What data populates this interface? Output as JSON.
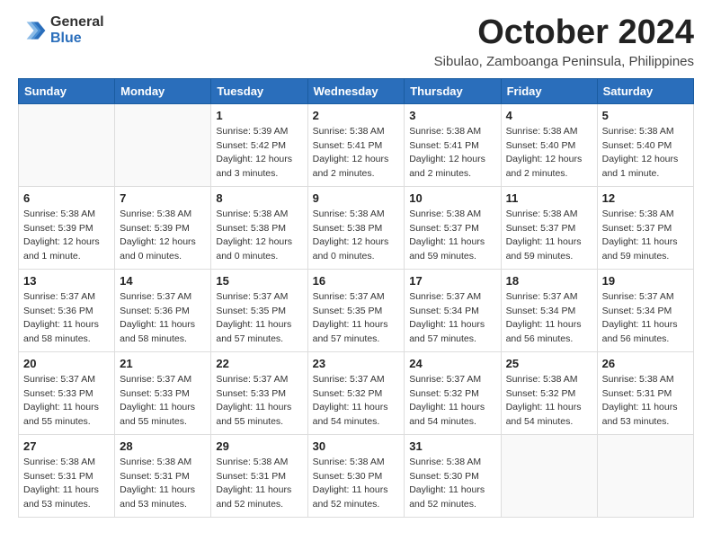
{
  "logo": {
    "general": "General",
    "blue": "Blue"
  },
  "title": "October 2024",
  "subtitle": "Sibulao, Zamboanga Peninsula, Philippines",
  "headers": [
    "Sunday",
    "Monday",
    "Tuesday",
    "Wednesday",
    "Thursday",
    "Friday",
    "Saturday"
  ],
  "weeks": [
    [
      {
        "day": "",
        "info": ""
      },
      {
        "day": "",
        "info": ""
      },
      {
        "day": "1",
        "info": "Sunrise: 5:39 AM\nSunset: 5:42 PM\nDaylight: 12 hours and 3 minutes."
      },
      {
        "day": "2",
        "info": "Sunrise: 5:38 AM\nSunset: 5:41 PM\nDaylight: 12 hours and 2 minutes."
      },
      {
        "day": "3",
        "info": "Sunrise: 5:38 AM\nSunset: 5:41 PM\nDaylight: 12 hours and 2 minutes."
      },
      {
        "day": "4",
        "info": "Sunrise: 5:38 AM\nSunset: 5:40 PM\nDaylight: 12 hours and 2 minutes."
      },
      {
        "day": "5",
        "info": "Sunrise: 5:38 AM\nSunset: 5:40 PM\nDaylight: 12 hours and 1 minute."
      }
    ],
    [
      {
        "day": "6",
        "info": "Sunrise: 5:38 AM\nSunset: 5:39 PM\nDaylight: 12 hours and 1 minute."
      },
      {
        "day": "7",
        "info": "Sunrise: 5:38 AM\nSunset: 5:39 PM\nDaylight: 12 hours and 0 minutes."
      },
      {
        "day": "8",
        "info": "Sunrise: 5:38 AM\nSunset: 5:38 PM\nDaylight: 12 hours and 0 minutes."
      },
      {
        "day": "9",
        "info": "Sunrise: 5:38 AM\nSunset: 5:38 PM\nDaylight: 12 hours and 0 minutes."
      },
      {
        "day": "10",
        "info": "Sunrise: 5:38 AM\nSunset: 5:37 PM\nDaylight: 11 hours and 59 minutes."
      },
      {
        "day": "11",
        "info": "Sunrise: 5:38 AM\nSunset: 5:37 PM\nDaylight: 11 hours and 59 minutes."
      },
      {
        "day": "12",
        "info": "Sunrise: 5:38 AM\nSunset: 5:37 PM\nDaylight: 11 hours and 59 minutes."
      }
    ],
    [
      {
        "day": "13",
        "info": "Sunrise: 5:37 AM\nSunset: 5:36 PM\nDaylight: 11 hours and 58 minutes."
      },
      {
        "day": "14",
        "info": "Sunrise: 5:37 AM\nSunset: 5:36 PM\nDaylight: 11 hours and 58 minutes."
      },
      {
        "day": "15",
        "info": "Sunrise: 5:37 AM\nSunset: 5:35 PM\nDaylight: 11 hours and 57 minutes."
      },
      {
        "day": "16",
        "info": "Sunrise: 5:37 AM\nSunset: 5:35 PM\nDaylight: 11 hours and 57 minutes."
      },
      {
        "day": "17",
        "info": "Sunrise: 5:37 AM\nSunset: 5:34 PM\nDaylight: 11 hours and 57 minutes."
      },
      {
        "day": "18",
        "info": "Sunrise: 5:37 AM\nSunset: 5:34 PM\nDaylight: 11 hours and 56 minutes."
      },
      {
        "day": "19",
        "info": "Sunrise: 5:37 AM\nSunset: 5:34 PM\nDaylight: 11 hours and 56 minutes."
      }
    ],
    [
      {
        "day": "20",
        "info": "Sunrise: 5:37 AM\nSunset: 5:33 PM\nDaylight: 11 hours and 55 minutes."
      },
      {
        "day": "21",
        "info": "Sunrise: 5:37 AM\nSunset: 5:33 PM\nDaylight: 11 hours and 55 minutes."
      },
      {
        "day": "22",
        "info": "Sunrise: 5:37 AM\nSunset: 5:33 PM\nDaylight: 11 hours and 55 minutes."
      },
      {
        "day": "23",
        "info": "Sunrise: 5:37 AM\nSunset: 5:32 PM\nDaylight: 11 hours and 54 minutes."
      },
      {
        "day": "24",
        "info": "Sunrise: 5:37 AM\nSunset: 5:32 PM\nDaylight: 11 hours and 54 minutes."
      },
      {
        "day": "25",
        "info": "Sunrise: 5:38 AM\nSunset: 5:32 PM\nDaylight: 11 hours and 54 minutes."
      },
      {
        "day": "26",
        "info": "Sunrise: 5:38 AM\nSunset: 5:31 PM\nDaylight: 11 hours and 53 minutes."
      }
    ],
    [
      {
        "day": "27",
        "info": "Sunrise: 5:38 AM\nSunset: 5:31 PM\nDaylight: 11 hours and 53 minutes."
      },
      {
        "day": "28",
        "info": "Sunrise: 5:38 AM\nSunset: 5:31 PM\nDaylight: 11 hours and 53 minutes."
      },
      {
        "day": "29",
        "info": "Sunrise: 5:38 AM\nSunset: 5:31 PM\nDaylight: 11 hours and 52 minutes."
      },
      {
        "day": "30",
        "info": "Sunrise: 5:38 AM\nSunset: 5:30 PM\nDaylight: 11 hours and 52 minutes."
      },
      {
        "day": "31",
        "info": "Sunrise: 5:38 AM\nSunset: 5:30 PM\nDaylight: 11 hours and 52 minutes."
      },
      {
        "day": "",
        "info": ""
      },
      {
        "day": "",
        "info": ""
      }
    ]
  ]
}
